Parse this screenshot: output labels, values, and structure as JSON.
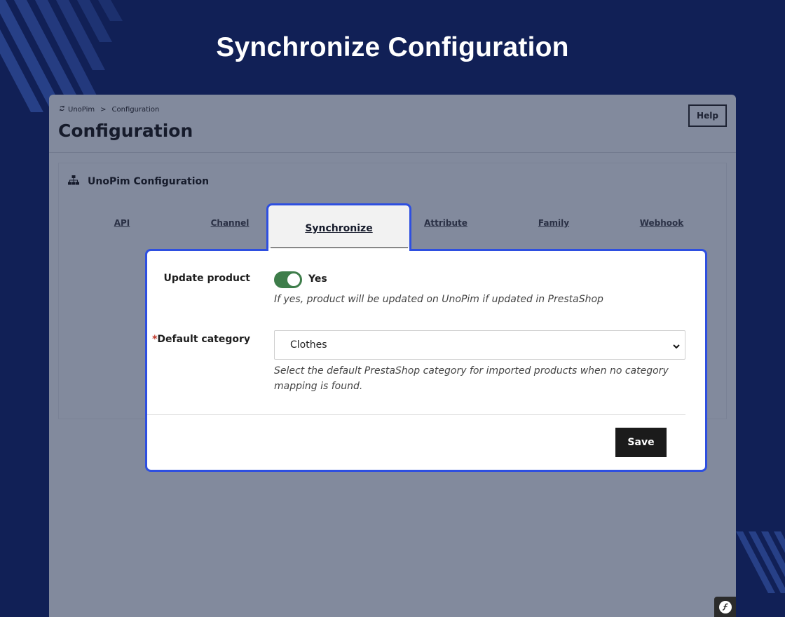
{
  "hero": {
    "title": "Synchronize Configuration"
  },
  "breadcrumb": {
    "root": "UnoPim",
    "separator": ">",
    "current": "Configuration"
  },
  "page": {
    "title": "Configuration",
    "help_label": "Help"
  },
  "card": {
    "title": "UnoPim Configuration",
    "icon": "sitemap-icon"
  },
  "tabs": [
    {
      "label": "API",
      "active": false
    },
    {
      "label": "Channel",
      "active": false
    },
    {
      "label": "Synchronize",
      "active": true
    },
    {
      "label": "Attribute",
      "active": false
    },
    {
      "label": "Family",
      "active": false
    },
    {
      "label": "Webhook",
      "active": false
    }
  ],
  "form": {
    "update_product": {
      "label": "Update product",
      "toggle_on": true,
      "toggle_text": "Yes",
      "help": "If yes, product will be updated on UnoPim if updated in PrestaShop"
    },
    "default_category": {
      "required_mark": "*",
      "label": "Default category",
      "value": "Clothes",
      "help_line1": "Select the default PrestaShop category for imported products when no category",
      "help_line2": "mapping is found."
    },
    "save_label": "Save"
  },
  "colors": {
    "background": "#112056",
    "highlight_border": "#2e4fe0",
    "toggle_on": "#3e7d4a",
    "save_button": "#1b1b1b"
  }
}
